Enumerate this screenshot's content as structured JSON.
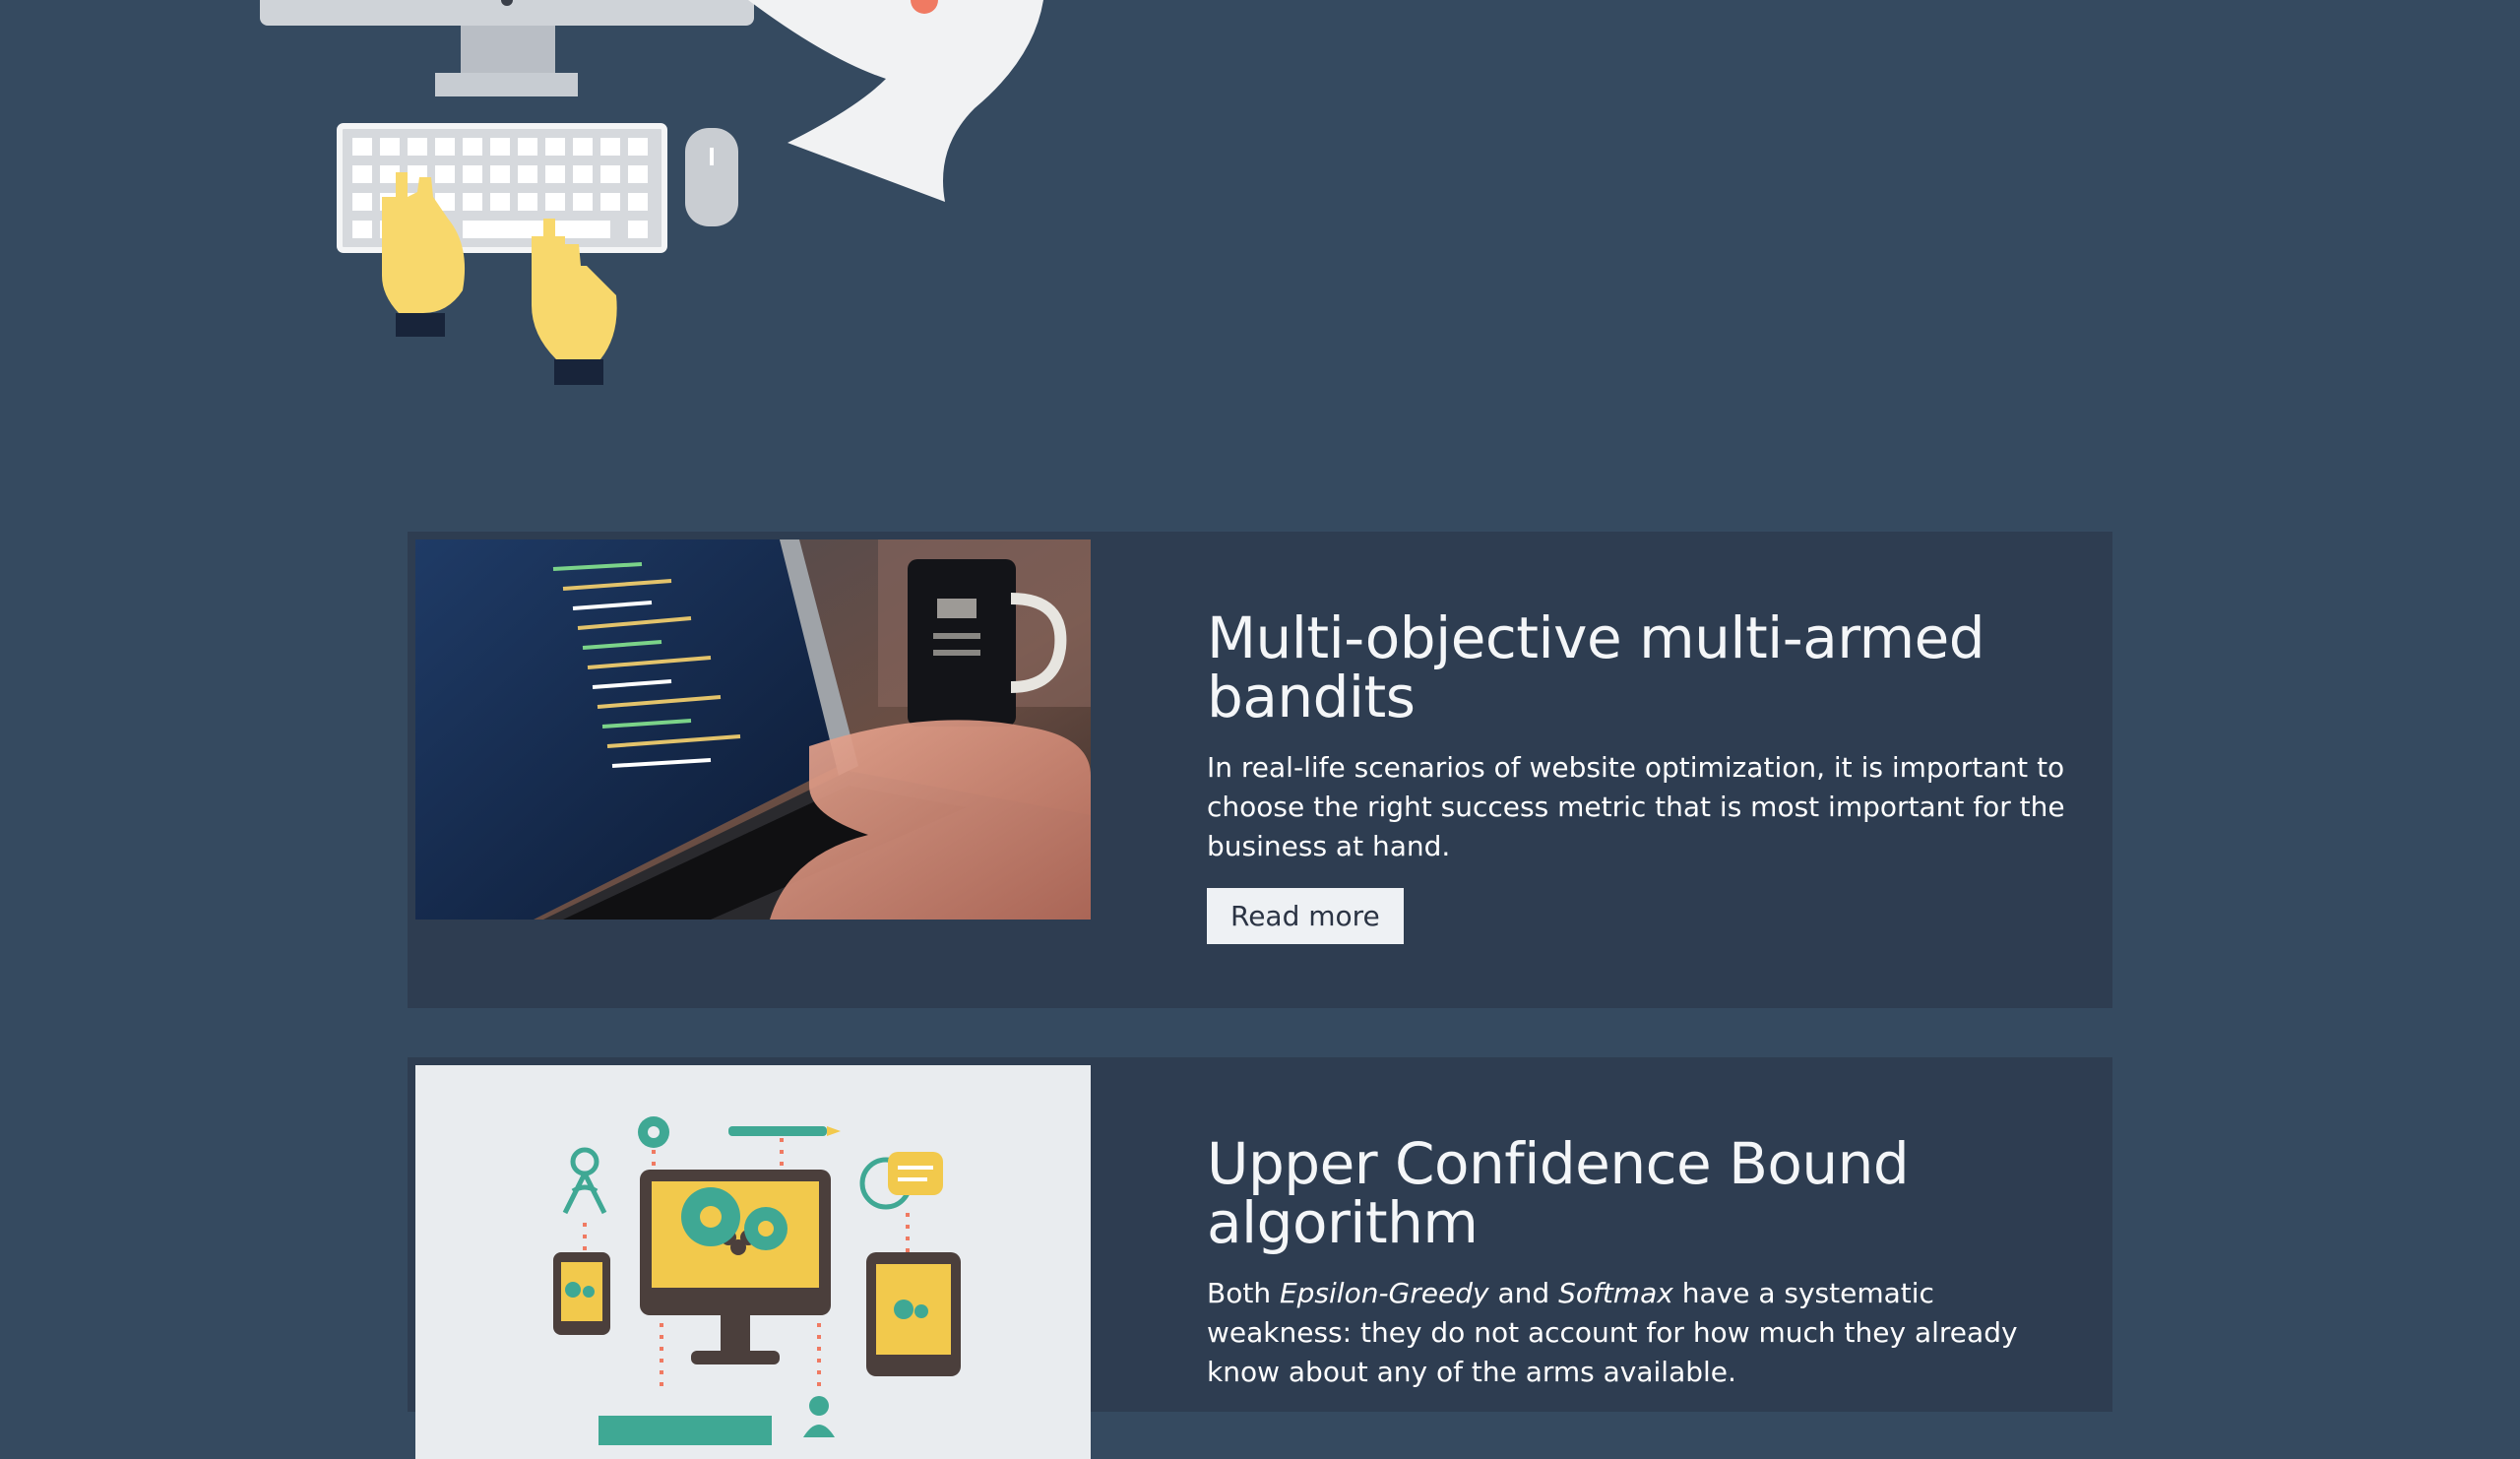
{
  "articles": [
    {
      "title": "Multi-objective multi-armed bandits",
      "description": "In real-life scenarios of website optimization, it is important to choose the right success metric that is most important for the business at hand.",
      "button_label": "Read more"
    },
    {
      "title": "Upper Confidence Bound algorithm",
      "description_parts": {
        "a": "Both ",
        "b": "Epsilon-Greedy",
        "c": " and ",
        "d": "Softmax",
        "e": " have a systematic weakness: they do not account for how much they already know about any of the arms available."
      }
    }
  ],
  "colors": {
    "background": "#354a60",
    "card": "#2e3d51",
    "button": "#eef1f4",
    "accent_yellow": "#f2c94c",
    "accent_teal": "#3fa894"
  }
}
